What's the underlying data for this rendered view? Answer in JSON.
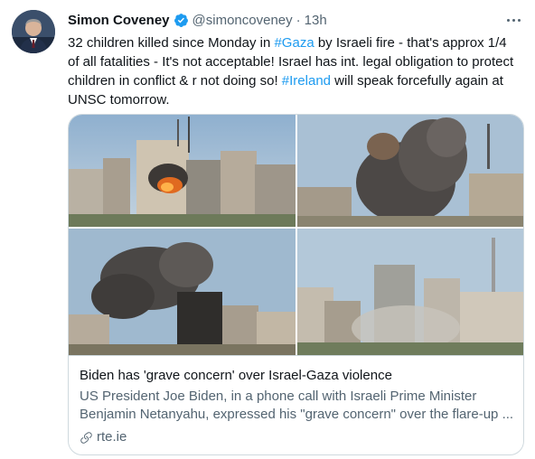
{
  "author": {
    "name": "Simon Coveney",
    "handle": "@simoncoveney",
    "separator": "·",
    "time": "13h",
    "verified": true,
    "avatar_icon": "profile-photo"
  },
  "tweet": {
    "segments": [
      {
        "text": "32 children killed since Monday in ",
        "type": "text"
      },
      {
        "text": "#Gaza",
        "type": "hashtag"
      },
      {
        "text": " by Israeli fire - that's approx 1/4 of all fatalities - It's not acceptable! Israel has int. legal obligation to protect children in conflict & r not doing so! ",
        "type": "text"
      },
      {
        "text": "#Ireland",
        "type": "hashtag"
      },
      {
        "text": " will speak forcefully again at UNSC tomorrow.",
        "type": "text"
      }
    ]
  },
  "card": {
    "title": "Biden has 'grave concern' over Israel-Gaza violence",
    "description": "US President Joe Biden, in a phone call with Israeli Prime Minister Benjamin Netanyahu, expressed his \"grave concern\" over the flare-up ...",
    "domain": "rte.ie",
    "image_icon": "news-photo-collage"
  },
  "colors": {
    "accent": "#1d9bf0",
    "text": "#0f1419",
    "secondary": "#536471",
    "border": "#cfd9de"
  }
}
